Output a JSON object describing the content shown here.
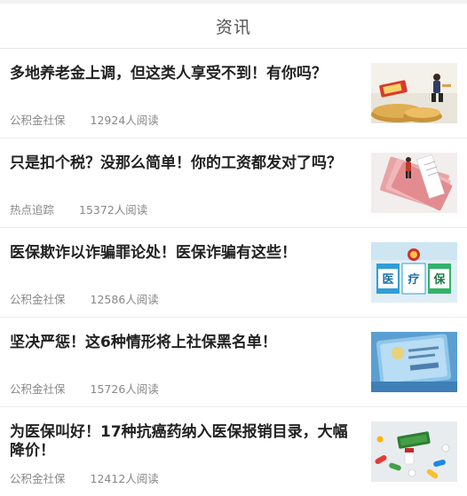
{
  "header": {
    "title": "资讯"
  },
  "articles": [
    {
      "title": "多地养老金上调，但这类人享受不到！有你吗？",
      "category": "公积金社保",
      "reads": "12924人阅读",
      "thumbnail_icon": "pension-coins-image"
    },
    {
      "title": "只是扣个税？没那么简单！你的工资都发对了吗？",
      "category": "热点追踪",
      "reads": "15372人阅读",
      "thumbnail_icon": "salary-banknotes-image"
    },
    {
      "title": "医保欺诈以诈骗罪论处！医保诈骗有这些！",
      "category": "公积金社保",
      "reads": "12586人阅读",
      "thumbnail_icon": "medical-insurance-image",
      "thumbnail_text": [
        "医",
        "疗",
        "保"
      ]
    },
    {
      "title": "坚决严惩！这6种情形将上社保黑名单！",
      "category": "公积金社保",
      "reads": "15726人阅读",
      "thumbnail_icon": "social-security-card-image"
    },
    {
      "title": "为医保叫好！17种抗癌药纳入医保报销目录，大幅降价！",
      "category": "公积金社保",
      "reads": "12412人阅读",
      "thumbnail_icon": "anticancer-pills-image"
    }
  ]
}
